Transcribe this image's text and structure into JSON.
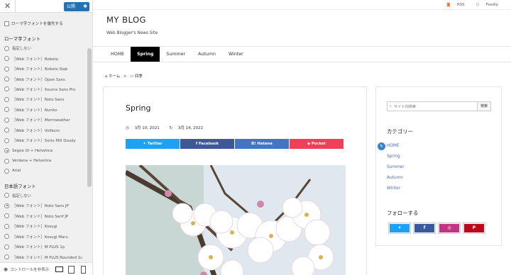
{
  "customizer": {
    "close_icon": "close-icon",
    "publish_label": "公開",
    "prefer_checkbox_label": "ローマ字フォントを優先する",
    "roman_group_title": "ローマ字フォント",
    "roman_options": [
      {
        "label": "指定しない",
        "checked": false
      },
      {
        "label": "［Web フォント］Roboto",
        "checked": false
      },
      {
        "label": "［Web フォント］Roboto Slab",
        "checked": false
      },
      {
        "label": "［Web フォント］Open Sans",
        "checked": false
      },
      {
        "label": "［Web フォント］Source Sans Pro",
        "checked": false
      },
      {
        "label": "［Web フォント］Noto Sans",
        "checked": false
      },
      {
        "label": "［Web フォント］Nunito",
        "checked": false
      },
      {
        "label": "［Web フォント］Merriweather",
        "checked": false
      },
      {
        "label": "［Web フォント］Vollkorn",
        "checked": false
      },
      {
        "label": "［Web フォント］Sorts Mill Goudy",
        "checked": false
      },
      {
        "label": "Segoe UI + Helvetica",
        "checked": true
      },
      {
        "label": "Verdana + Helvetica",
        "checked": false
      },
      {
        "label": "Arial",
        "checked": false
      }
    ],
    "japanese_group_title": "日本語フォント",
    "japanese_options": [
      {
        "label": "指定しない",
        "checked": false
      },
      {
        "label": "［Web フォント］Noto Sans JP",
        "checked": true
      },
      {
        "label": "［Web フォント］Noto Serif JP",
        "checked": false
      },
      {
        "label": "［Web フォント］Kosugi",
        "checked": false
      },
      {
        "label": "［Web フォント］Kosugi Maru",
        "checked": false
      },
      {
        "label": "［Web フォント］M PLUS 1p",
        "checked": false
      },
      {
        "label": "［Web フォント］M PLUS Rounded 1c",
        "checked": false
      }
    ],
    "footer_label": "コントロールを非表示",
    "accent_color": "#2271b1"
  },
  "site": {
    "topbar": {
      "rss": "RSS",
      "feedly": "Feedly"
    },
    "title": "MY BLOG",
    "tagline": "Web Blogger's News Site",
    "nav": [
      "HOME",
      "Spring",
      "Summer",
      "Autumn",
      "Winter"
    ],
    "nav_active": "Spring",
    "breadcrumb": {
      "home": "ホーム",
      "sep": ">",
      "category": "四季"
    },
    "post": {
      "title": "Spring",
      "published": "3月 10, 2021",
      "updated": "3月 14, 2022",
      "share": [
        {
          "label": "Twitter",
          "color": "#1da1f2",
          "icon": "twitter-icon"
        },
        {
          "label": "Facebook",
          "color": "#3b5998",
          "icon": "facebook-icon"
        },
        {
          "label": "Hatena",
          "color": "#4474c4",
          "icon": "hatena-icon"
        },
        {
          "label": "Pocket",
          "color": "#ef4056",
          "icon": "pocket-icon"
        }
      ]
    },
    "sidebar": {
      "search_placeholder": "サイト内検索",
      "search_button": "検索",
      "categories_title": "カテゴリー",
      "categories": [
        "HOME",
        "Spring",
        "Summer",
        "Autumn",
        "Winter"
      ],
      "follow_title": "フォローする",
      "follow": [
        {
          "icon": "twitter-icon",
          "color": "#1da1f2"
        },
        {
          "icon": "facebook-icon",
          "color": "#3b5998"
        },
        {
          "icon": "instagram-icon",
          "color": "#c13584"
        },
        {
          "icon": "pinterest-icon",
          "color": "#bd081c"
        }
      ]
    }
  }
}
